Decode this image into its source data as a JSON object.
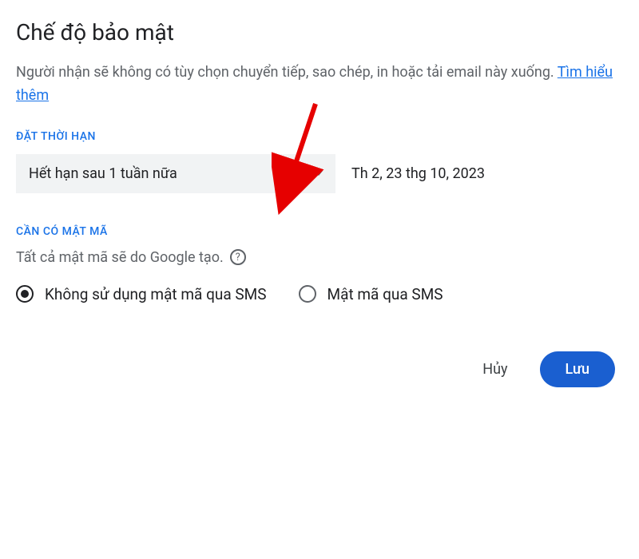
{
  "dialog": {
    "title": "Chế độ bảo mật",
    "description_part1": "Người nhận sẽ không có tùy chọn chuyển tiếp, sao chép, in hoặc tải email này xuống. ",
    "learn_more": "Tìm hiểu thêm"
  },
  "expiry": {
    "section_label": "ĐẶT THỜI HẠN",
    "dropdown_value": "Hết hạn sau 1 tuần nữa",
    "date": "Th 2, 23 thg 10, 2023"
  },
  "passcode": {
    "section_label": "CẦN CÓ MẬT MÃ",
    "description": "Tất cả mật mã sẽ do Google tạo.",
    "options": {
      "no_sms": "Không sử dụng mật mã qua SMS",
      "sms": "Mật mã qua SMS"
    }
  },
  "buttons": {
    "cancel": "Hủy",
    "save": "Lưu"
  }
}
